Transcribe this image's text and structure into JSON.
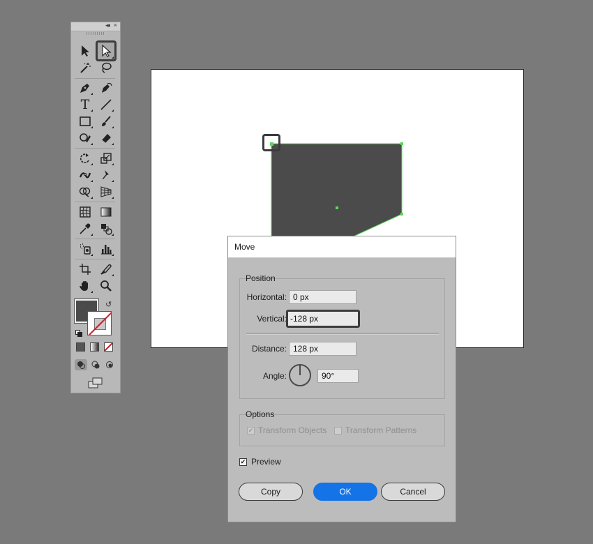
{
  "toolbar": {
    "collapse_glyph": "◂◂",
    "close_glyph": "×",
    "tools": [
      {
        "name": "selection-tool-icon"
      },
      {
        "name": "direct-selection-tool-icon",
        "selected": true
      },
      {
        "name": "magic-wand-tool-icon"
      },
      {
        "name": "lasso-tool-icon"
      },
      {
        "name": "pen-tool-icon"
      },
      {
        "name": "curvature-tool-icon"
      },
      {
        "name": "type-tool-icon",
        "glyph": "T"
      },
      {
        "name": "line-segment-tool-icon"
      },
      {
        "name": "rectangle-tool-icon"
      },
      {
        "name": "paintbrush-tool-icon"
      },
      {
        "name": "shaper-tool-icon"
      },
      {
        "name": "eraser-tool-icon"
      },
      {
        "name": "rotate-tool-icon"
      },
      {
        "name": "scale-tool-icon"
      },
      {
        "name": "width-tool-icon"
      },
      {
        "name": "puppet-warp-tool-icon"
      },
      {
        "name": "shape-builder-tool-icon"
      },
      {
        "name": "perspective-grid-tool-icon"
      },
      {
        "name": "mesh-tool-icon"
      },
      {
        "name": "gradient-tool-icon"
      },
      {
        "name": "eyedropper-tool-icon"
      },
      {
        "name": "blend-tool-icon"
      },
      {
        "name": "symbol-sprayer-tool-icon"
      },
      {
        "name": "column-graph-tool-icon"
      },
      {
        "name": "artboard-tool-icon"
      },
      {
        "name": "slice-tool-icon"
      },
      {
        "name": "hand-tool-icon"
      },
      {
        "name": "zoom-tool-icon"
      }
    ],
    "fill_color": "#4b4b4b",
    "swap_glyph": "↺"
  },
  "artboard": {
    "background": "#ffffff",
    "shape_fill": "#4b4b4b",
    "selection_color": "#5bd95b"
  },
  "dialog": {
    "title": "Move",
    "position_group": "Position",
    "horizontal_label": "Horizontal:",
    "horizontal_value": "0 px",
    "vertical_label": "Vertical:",
    "vertical_value": "-128 px",
    "distance_label": "Distance:",
    "distance_value": "128 px",
    "angle_label": "Angle:",
    "angle_value": "90°",
    "options_group": "Options",
    "transform_objects_label": "Transform Objects",
    "transform_patterns_label": "Transform Patterns",
    "preview_label": "Preview",
    "copy_label": "Copy",
    "ok_label": "OK",
    "cancel_label": "Cancel",
    "checkmark": "✔",
    "accent_color": "#1473e6"
  }
}
